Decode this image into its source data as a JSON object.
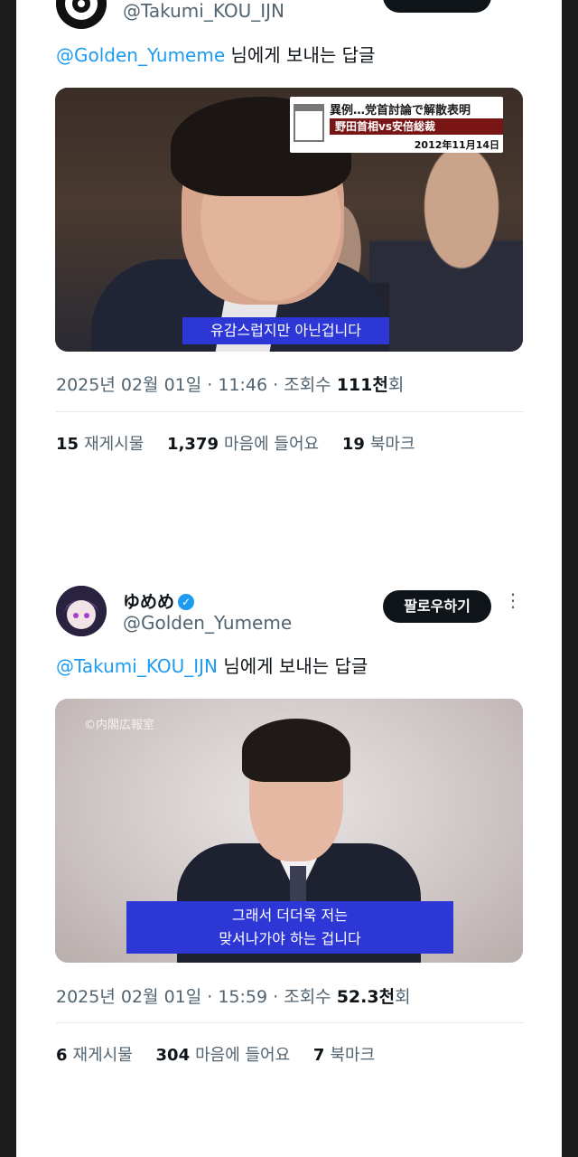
{
  "tweets": [
    {
      "handle": "@Takumi_KOU_IJN",
      "reply_prefix_mention": "@Golden_Yumeme",
      "reply_suffix": " 님에게 보내는 답글",
      "media": {
        "headline_line1": "異例…党首討論で解散表明",
        "headline_line2": "野田首相vs安倍総裁",
        "headline_date": "2012年11月14日",
        "subtitle": "유감스럽지만 아닌겁니다"
      },
      "meta": {
        "date": "2025년 02월 01일 · 11:46 · 조회수 ",
        "views": "111천",
        "views_suffix": "회"
      },
      "stats": {
        "retweets": "15",
        "retweets_label": "재게시물",
        "likes": "1,379",
        "likes_label": "마음에 들어요",
        "bookmarks": "19",
        "bookmarks_label": "북마크"
      }
    },
    {
      "display_name": "ゆめめ",
      "handle": "@Golden_Yumeme",
      "follow_label": "팔로우하기",
      "reply_prefix_mention": "@Takumi_KOU_IJN",
      "reply_suffix": " 님에게 보내는 답글",
      "media": {
        "watermark": "©内閣広報室",
        "subtitle_line1": "그래서 더더욱 저는",
        "subtitle_line2": "맞서나가야 하는 겁니다"
      },
      "meta": {
        "date": "2025년 02월 01일 · 15:59 · 조회수 ",
        "views": "52.3천",
        "views_suffix": "회"
      },
      "stats": {
        "retweets": "6",
        "retweets_label": "재게시물",
        "likes": "304",
        "likes_label": "마음에 들어요",
        "bookmarks": "7",
        "bookmarks_label": "북마크"
      }
    }
  ],
  "colors": {
    "link": "#1d9bf0",
    "follow_bg": "#0f1419",
    "subtitle_bg": "#2d37d6"
  }
}
